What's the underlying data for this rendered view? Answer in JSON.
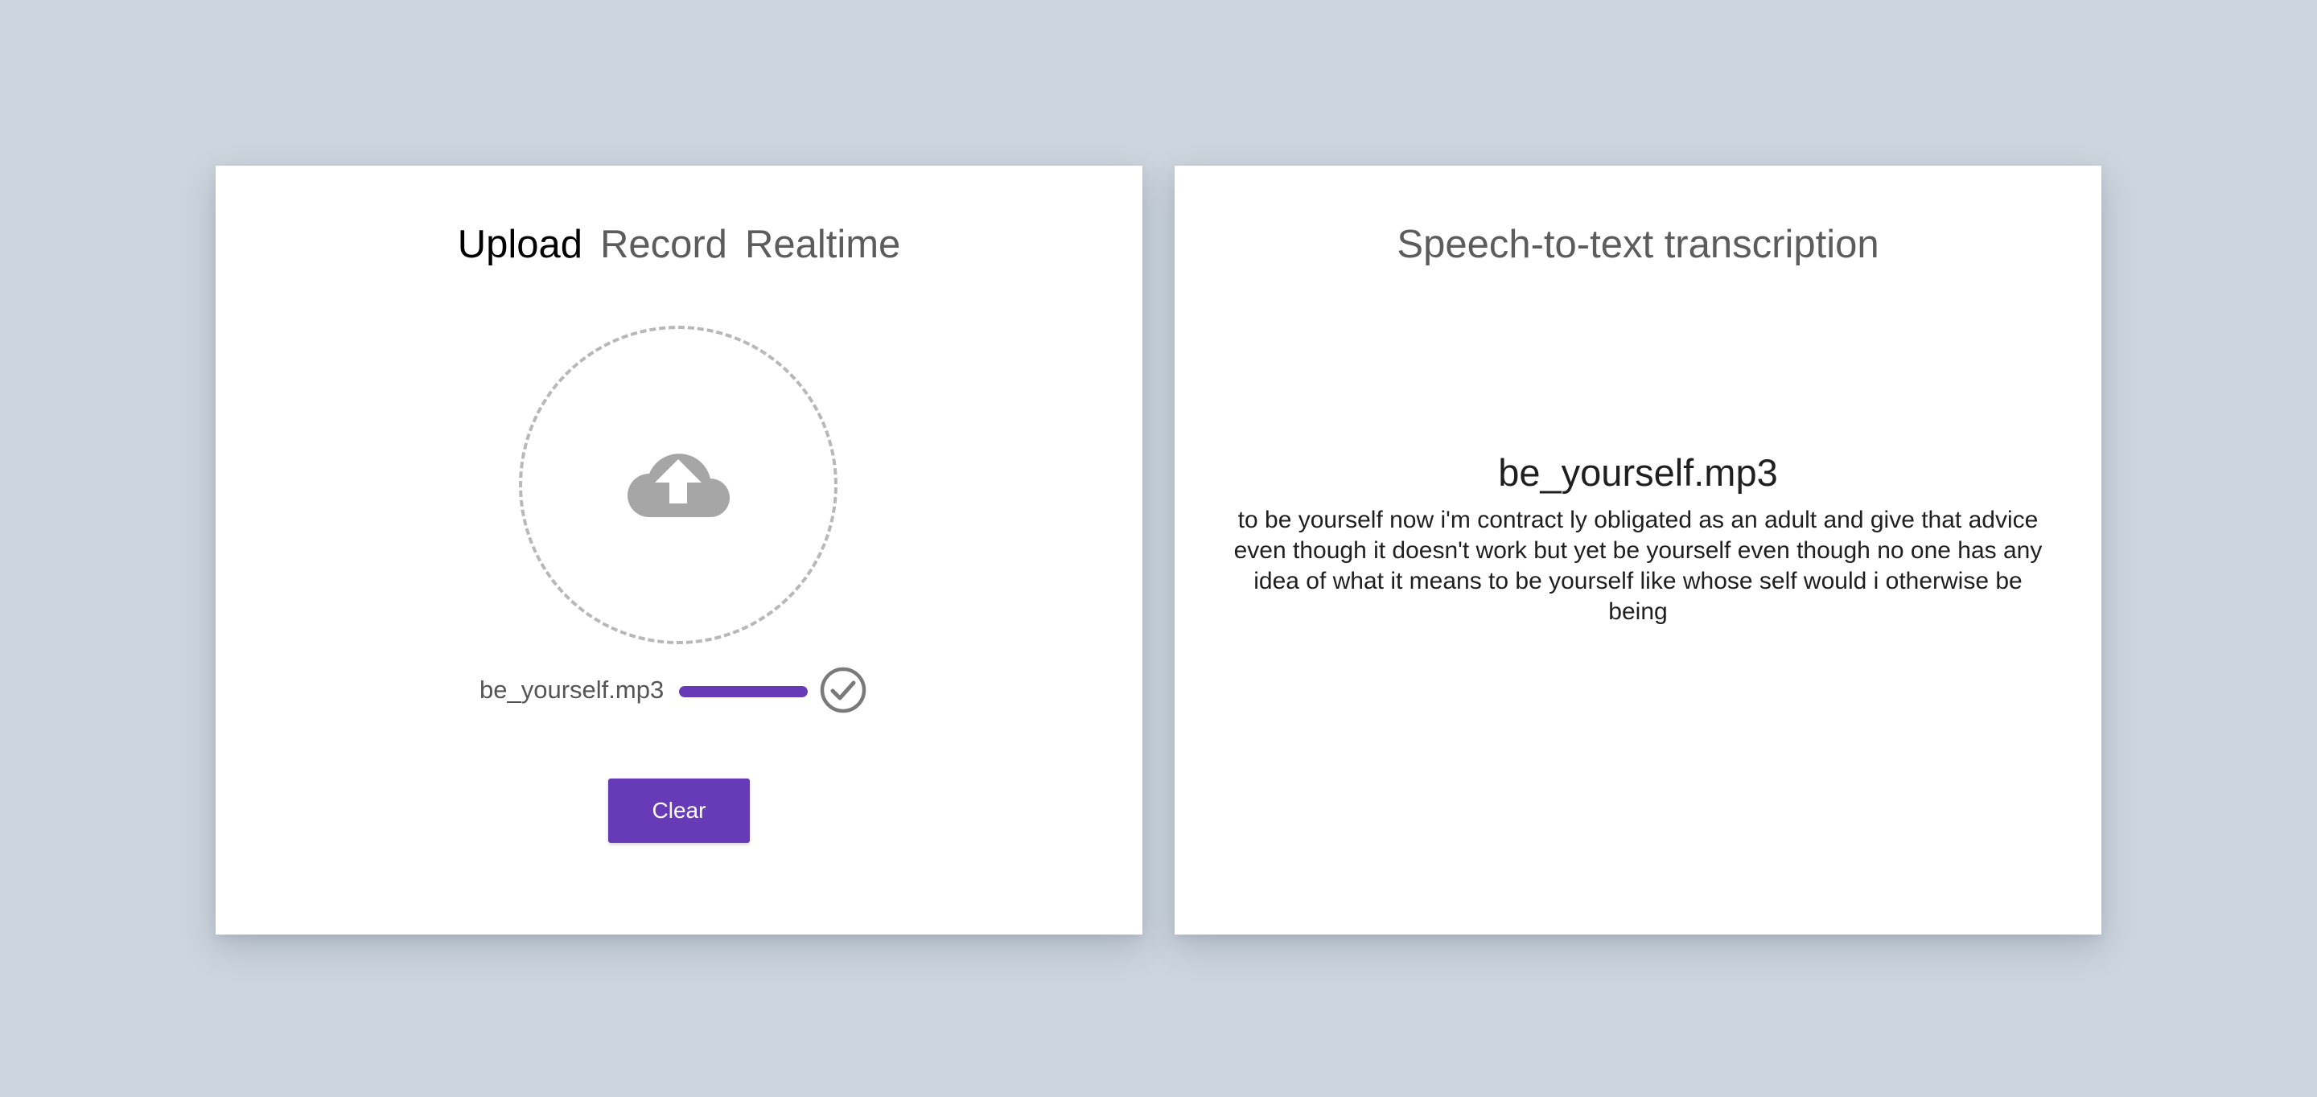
{
  "upload_panel": {
    "tabs": [
      {
        "label": "Upload",
        "active": true
      },
      {
        "label": "Record",
        "active": false
      },
      {
        "label": "Realtime",
        "active": false
      }
    ],
    "dropzone_icon": "cloud-upload-icon",
    "file": {
      "name": "be_yourself.mp3",
      "progress_percent": 100,
      "status_icon": "check-circle-icon"
    },
    "clear_label": "Clear"
  },
  "transcript_panel": {
    "title": "Speech-to-text transcription",
    "result": {
      "file_name": "be_yourself.mp3",
      "text": "to be yourself now i'm contract ly obligated as an adult and give that advice even though it doesn't work but yet be yourself even though no one has any idea of what it means to be yourself like whose self would i otherwise be being"
    }
  },
  "colors": {
    "background": "#cdd5de",
    "accent": "#673ab7",
    "icon_gray": "#a6a6a6",
    "dashed_border": "#b8b8b8"
  }
}
